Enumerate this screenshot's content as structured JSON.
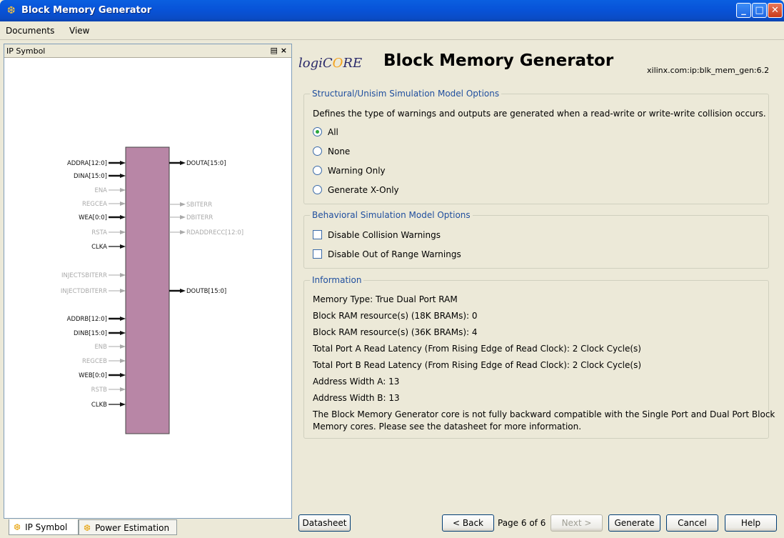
{
  "window": {
    "title": "Block Memory Generator",
    "icon": "logicore-icon",
    "buttons": [
      "minimize",
      "maximize",
      "close"
    ]
  },
  "menu": [
    "Documents",
    "View"
  ],
  "left_panel": {
    "title": "IP Symbol",
    "controls": "\u0000",
    "float_close": "❒ ×",
    "symbol": {
      "left_pins": [
        {
          "name": "ADDRA[12:0]",
          "active": true,
          "bus": true
        },
        {
          "name": "DINA[15:0]",
          "active": true,
          "bus": true
        },
        {
          "name": "ENA",
          "active": false,
          "bus": false
        },
        {
          "name": "REGCEA",
          "active": false,
          "bus": false
        },
        {
          "name": "WEA[0:0]",
          "active": true,
          "bus": true
        },
        {
          "name": "RSTA",
          "active": false,
          "bus": false
        },
        {
          "name": "CLKA",
          "active": true,
          "bus": false
        },
        {
          "name": "INJECTSBITERR",
          "active": false,
          "bus": false
        },
        {
          "name": "INJECTDBITERR",
          "active": false,
          "bus": false
        },
        {
          "name": "ADDRB[12:0]",
          "active": true,
          "bus": true
        },
        {
          "name": "DINB[15:0]",
          "active": true,
          "bus": true
        },
        {
          "name": "ENB",
          "active": false,
          "bus": false
        },
        {
          "name": "REGCEB",
          "active": false,
          "bus": false
        },
        {
          "name": "WEB[0:0]",
          "active": true,
          "bus": true
        },
        {
          "name": "RSTB",
          "active": false,
          "bus": false
        },
        {
          "name": "CLKB",
          "active": true,
          "bus": false
        }
      ],
      "right_pins": [
        {
          "name": "DOUTA[15:0]",
          "active": true,
          "bus": true
        },
        {
          "name": "SBITERR",
          "active": false,
          "bus": false
        },
        {
          "name": "DBITERR",
          "active": false,
          "bus": false
        },
        {
          "name": "RDADDRECC[12:0]",
          "active": false,
          "bus": true
        },
        {
          "name": "DOUTB[15:0]",
          "active": true,
          "bus": true
        }
      ],
      "block_color": "#b886a6"
    }
  },
  "tabs": [
    {
      "label": "IP Symbol",
      "active": true
    },
    {
      "label": "Power Estimation",
      "active": false
    }
  ],
  "header": {
    "logo_pre": "logiC",
    "logo_o": "O",
    "logo_post": "RE",
    "title": "Block Memory Generator",
    "vlnv": "xilinx.com:ip:blk_mem_gen:6.2"
  },
  "structural": {
    "title": "Structural/Unisim Simulation Model Options",
    "description": "Defines the type of warnings and outputs are generated when a read-write or write-write collision occurs.",
    "options": [
      "All",
      "None",
      "Warning Only",
      "Generate X-Only"
    ],
    "selected": "All"
  },
  "behavioral": {
    "title": "Behavioral Simulation Model Options",
    "options": [
      {
        "label": "Disable Collision Warnings",
        "checked": false
      },
      {
        "label": "Disable Out of Range Warnings",
        "checked": false
      }
    ]
  },
  "information": {
    "title": "Information",
    "lines": [
      "Memory Type: True Dual Port RAM",
      "Block RAM resource(s) (18K BRAMs): 0",
      "Block RAM resource(s) (36K BRAMs): 4",
      "Total Port A Read Latency (From Rising Edge of Read Clock): 2 Clock Cycle(s)",
      "Total Port B Read Latency (From Rising Edge of Read Clock): 2 Clock Cycle(s)",
      "Address Width A: 13",
      "Address Width B: 13",
      "The Block Memory Generator core is not fully backward compatible with the Single Port and Dual Port Block",
      "Memory cores. Please see the datasheet for more information."
    ]
  },
  "footer": {
    "datasheet": "Datasheet",
    "back": "< Back",
    "page": "Page 6 of 6",
    "next": "Next >",
    "generate": "Generate",
    "cancel": "Cancel",
    "help": "Help"
  }
}
